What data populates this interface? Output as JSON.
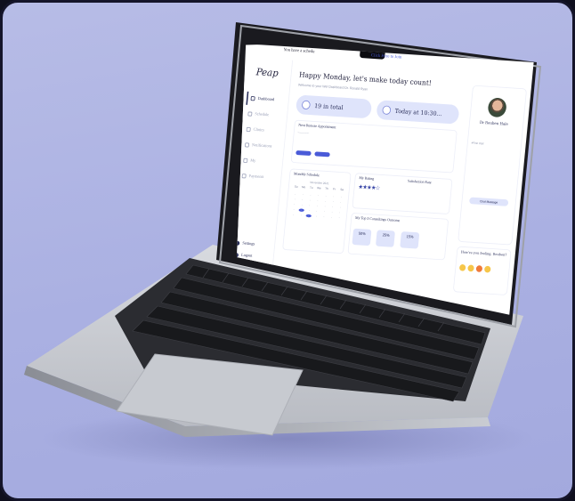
{
  "banner": {
    "text": "You have a schedu",
    "link": "Click Here to Join"
  },
  "logo": "Peap",
  "greeting": "Happy Monday, let's make today count!",
  "greeting_sub": "Welcome to your Wel Dashboard Dr. Ronald Ryan",
  "nav": [
    "Dashboard",
    "Schedule",
    "Clinics",
    "Notifications",
    "My",
    "Payments"
  ],
  "side_bottom": [
    "Settings",
    "Logout"
  ],
  "pill_left": "19 in total",
  "pill_right": "Today at 10:30...",
  "next_appt_title": "Next Remote Appointment",
  "calendar_title": "Monthly Schedule",
  "calendar_month": "November 2021",
  "calendar_days": [
    "Su",
    "Mo",
    "Tu",
    "We",
    "Th",
    "Fr",
    "Sa"
  ],
  "rating_title": "My Rating",
  "satisfaction_title": "Satisfaction Rate",
  "consultations_title": "My Top 3 Consultings Outcome",
  "outcomes": [
    "50%",
    "25%",
    "15%"
  ],
  "doctor_name": "Dr Reuben Hale",
  "first_visit": "#First Visit",
  "message_button": "Chat Message",
  "mood_title": "How're you feeling, Reuben?",
  "colors": {
    "background": "#aab0e2",
    "accent": "#4a5bd8",
    "pill": "#dfe4fb",
    "ink": "#2a2f5a"
  }
}
